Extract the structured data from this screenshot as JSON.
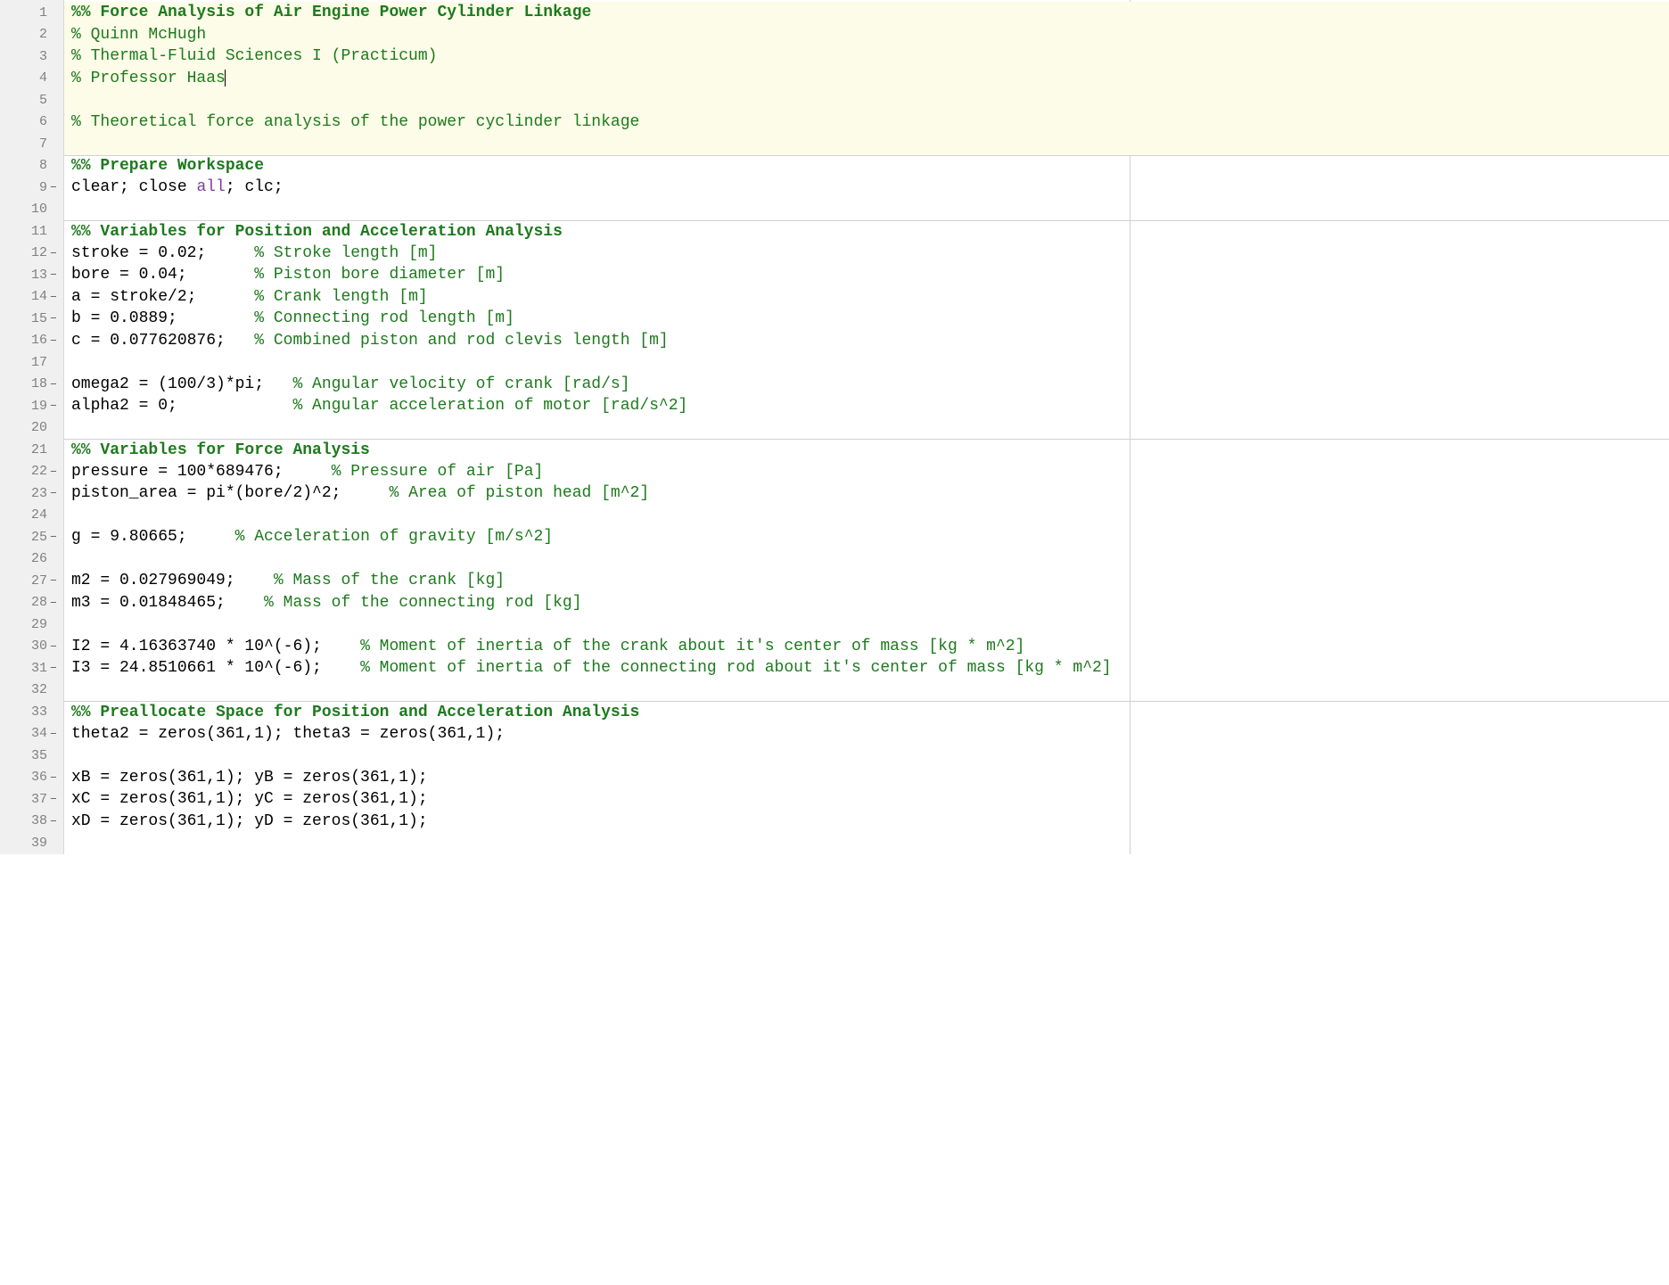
{
  "editor": {
    "cursor_line": 4,
    "right_margin_col": 80,
    "lines": [
      {
        "n": 1,
        "dash": false,
        "section_bg": true,
        "divider": false,
        "spans": [
          {
            "cls": "section-header",
            "t": "%% Force Analysis of Air Engine Power Cylinder Linkage"
          }
        ]
      },
      {
        "n": 2,
        "dash": false,
        "section_bg": true,
        "divider": false,
        "spans": [
          {
            "cls": "comment",
            "t": "% Quinn McHugh"
          }
        ]
      },
      {
        "n": 3,
        "dash": false,
        "section_bg": true,
        "divider": false,
        "spans": [
          {
            "cls": "comment",
            "t": "% Thermal-Fluid Sciences I (Practicum)"
          }
        ]
      },
      {
        "n": 4,
        "dash": false,
        "section_bg": true,
        "divider": false,
        "spans": [
          {
            "cls": "comment",
            "t": "% Professor Haas"
          }
        ],
        "cursor_after": true
      },
      {
        "n": 5,
        "dash": false,
        "section_bg": true,
        "divider": false,
        "spans": []
      },
      {
        "n": 6,
        "dash": false,
        "section_bg": true,
        "divider": false,
        "spans": [
          {
            "cls": "comment",
            "t": "% Theoretical force analysis of the power cyclinder linkage"
          }
        ]
      },
      {
        "n": 7,
        "dash": false,
        "section_bg": true,
        "divider": false,
        "spans": []
      },
      {
        "n": 8,
        "dash": false,
        "section_bg": false,
        "divider": true,
        "spans": [
          {
            "cls": "section-header",
            "t": "%% Prepare Workspace"
          }
        ]
      },
      {
        "n": 9,
        "dash": true,
        "section_bg": false,
        "divider": false,
        "spans": [
          {
            "cls": "plain",
            "t": "clear; close "
          },
          {
            "cls": "keyword",
            "t": "all"
          },
          {
            "cls": "plain",
            "t": "; clc;"
          }
        ]
      },
      {
        "n": 10,
        "dash": false,
        "section_bg": false,
        "divider": false,
        "spans": []
      },
      {
        "n": 11,
        "dash": false,
        "section_bg": false,
        "divider": true,
        "spans": [
          {
            "cls": "section-header",
            "t": "%% Variables for Position and Acceleration Analysis"
          }
        ]
      },
      {
        "n": 12,
        "dash": true,
        "section_bg": false,
        "divider": false,
        "spans": [
          {
            "cls": "plain",
            "t": "stroke = 0.02;     "
          },
          {
            "cls": "comment",
            "t": "% Stroke length [m]"
          }
        ]
      },
      {
        "n": 13,
        "dash": true,
        "section_bg": false,
        "divider": false,
        "spans": [
          {
            "cls": "plain",
            "t": "bore = 0.04;       "
          },
          {
            "cls": "comment",
            "t": "% Piston bore diameter [m]"
          }
        ]
      },
      {
        "n": 14,
        "dash": true,
        "section_bg": false,
        "divider": false,
        "spans": [
          {
            "cls": "plain",
            "t": "a = stroke/2;      "
          },
          {
            "cls": "comment",
            "t": "% Crank length [m]"
          }
        ]
      },
      {
        "n": 15,
        "dash": true,
        "section_bg": false,
        "divider": false,
        "spans": [
          {
            "cls": "plain",
            "t": "b = 0.0889;        "
          },
          {
            "cls": "comment",
            "t": "% Connecting rod length [m]"
          }
        ]
      },
      {
        "n": 16,
        "dash": true,
        "section_bg": false,
        "divider": false,
        "spans": [
          {
            "cls": "plain",
            "t": "c = 0.077620876;   "
          },
          {
            "cls": "comment",
            "t": "% Combined piston and rod clevis length [m]"
          }
        ]
      },
      {
        "n": 17,
        "dash": false,
        "section_bg": false,
        "divider": false,
        "spans": []
      },
      {
        "n": 18,
        "dash": true,
        "section_bg": false,
        "divider": false,
        "spans": [
          {
            "cls": "plain",
            "t": "omega2 = (100/3)*pi;   "
          },
          {
            "cls": "comment",
            "t": "% Angular velocity of crank [rad/s]"
          }
        ]
      },
      {
        "n": 19,
        "dash": true,
        "section_bg": false,
        "divider": false,
        "spans": [
          {
            "cls": "plain",
            "t": "alpha2 = 0;            "
          },
          {
            "cls": "comment",
            "t": "% Angular acceleration of motor [rad/s^2]"
          }
        ]
      },
      {
        "n": 20,
        "dash": false,
        "section_bg": false,
        "divider": false,
        "spans": []
      },
      {
        "n": 21,
        "dash": false,
        "section_bg": false,
        "divider": true,
        "spans": [
          {
            "cls": "section-header",
            "t": "%% Variables for Force Analysis"
          }
        ]
      },
      {
        "n": 22,
        "dash": true,
        "section_bg": false,
        "divider": false,
        "spans": [
          {
            "cls": "plain",
            "t": "pressure = 100*689476;     "
          },
          {
            "cls": "comment",
            "t": "% Pressure of air [Pa]"
          }
        ]
      },
      {
        "n": 23,
        "dash": true,
        "section_bg": false,
        "divider": false,
        "spans": [
          {
            "cls": "plain",
            "t": "piston_area = pi*(bore/2)^2;     "
          },
          {
            "cls": "comment",
            "t": "% Area of piston head [m^2]"
          }
        ]
      },
      {
        "n": 24,
        "dash": false,
        "section_bg": false,
        "divider": false,
        "spans": []
      },
      {
        "n": 25,
        "dash": true,
        "section_bg": false,
        "divider": false,
        "spans": [
          {
            "cls": "plain",
            "t": "g = 9.80665;     "
          },
          {
            "cls": "comment",
            "t": "% Acceleration of gravity [m/s^2]"
          }
        ]
      },
      {
        "n": 26,
        "dash": false,
        "section_bg": false,
        "divider": false,
        "spans": []
      },
      {
        "n": 27,
        "dash": true,
        "section_bg": false,
        "divider": false,
        "spans": [
          {
            "cls": "plain",
            "t": "m2 = 0.027969049;    "
          },
          {
            "cls": "comment",
            "t": "% Mass of the crank [kg]"
          }
        ]
      },
      {
        "n": 28,
        "dash": true,
        "section_bg": false,
        "divider": false,
        "spans": [
          {
            "cls": "plain",
            "t": "m3 = 0.01848465;    "
          },
          {
            "cls": "comment",
            "t": "% Mass of the connecting rod [kg]"
          }
        ]
      },
      {
        "n": 29,
        "dash": false,
        "section_bg": false,
        "divider": false,
        "spans": []
      },
      {
        "n": 30,
        "dash": true,
        "section_bg": false,
        "divider": false,
        "spans": [
          {
            "cls": "plain",
            "t": "I2 = 4.16363740 * 10^(-6);    "
          },
          {
            "cls": "comment",
            "t": "% Moment of inertia of the crank about it's center of mass [kg * m^2]"
          }
        ]
      },
      {
        "n": 31,
        "dash": true,
        "section_bg": false,
        "divider": false,
        "spans": [
          {
            "cls": "plain",
            "t": "I3 = 24.8510661 * 10^(-6);    "
          },
          {
            "cls": "comment",
            "t": "% Moment of inertia of the connecting rod about it's center of mass [kg * m^2]"
          }
        ]
      },
      {
        "n": 32,
        "dash": false,
        "section_bg": false,
        "divider": false,
        "spans": []
      },
      {
        "n": 33,
        "dash": false,
        "section_bg": false,
        "divider": true,
        "spans": [
          {
            "cls": "section-header",
            "t": "%% Preallocate Space for Position and Acceleration Analysis"
          }
        ]
      },
      {
        "n": 34,
        "dash": true,
        "section_bg": false,
        "divider": false,
        "spans": [
          {
            "cls": "plain",
            "t": "theta2 = zeros(361,1); theta3 = zeros(361,1);"
          }
        ]
      },
      {
        "n": 35,
        "dash": false,
        "section_bg": false,
        "divider": false,
        "spans": []
      },
      {
        "n": 36,
        "dash": true,
        "section_bg": false,
        "divider": false,
        "spans": [
          {
            "cls": "plain",
            "t": "xB = zeros(361,1); yB = zeros(361,1);"
          }
        ]
      },
      {
        "n": 37,
        "dash": true,
        "section_bg": false,
        "divider": false,
        "spans": [
          {
            "cls": "plain",
            "t": "xC = zeros(361,1); yC = zeros(361,1);"
          }
        ]
      },
      {
        "n": 38,
        "dash": true,
        "section_bg": false,
        "divider": false,
        "spans": [
          {
            "cls": "plain",
            "t": "xD = zeros(361,1); yD = zeros(361,1);"
          }
        ]
      },
      {
        "n": 39,
        "dash": false,
        "section_bg": false,
        "divider": false,
        "spans": []
      }
    ]
  }
}
